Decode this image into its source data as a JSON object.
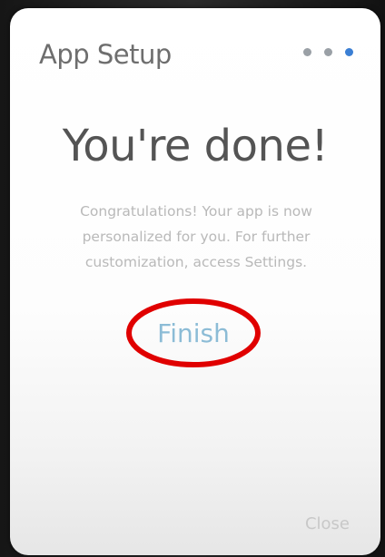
{
  "dialog": {
    "title": "App Setup",
    "steps": {
      "total": 3,
      "current": 3
    },
    "headline": "You're done!",
    "message": "Congratulations! Your app is now personalized for you. For further customization, access Settings.",
    "primary_action": "Finish",
    "secondary_action": "Close"
  },
  "annotation": {
    "shape": "ellipse",
    "target": "finish-button",
    "color": "#e00000"
  },
  "colors": {
    "accent": "#3b7fd4",
    "finish_text": "#8cbcd6",
    "dot_inactive": "#9aa0a6"
  }
}
